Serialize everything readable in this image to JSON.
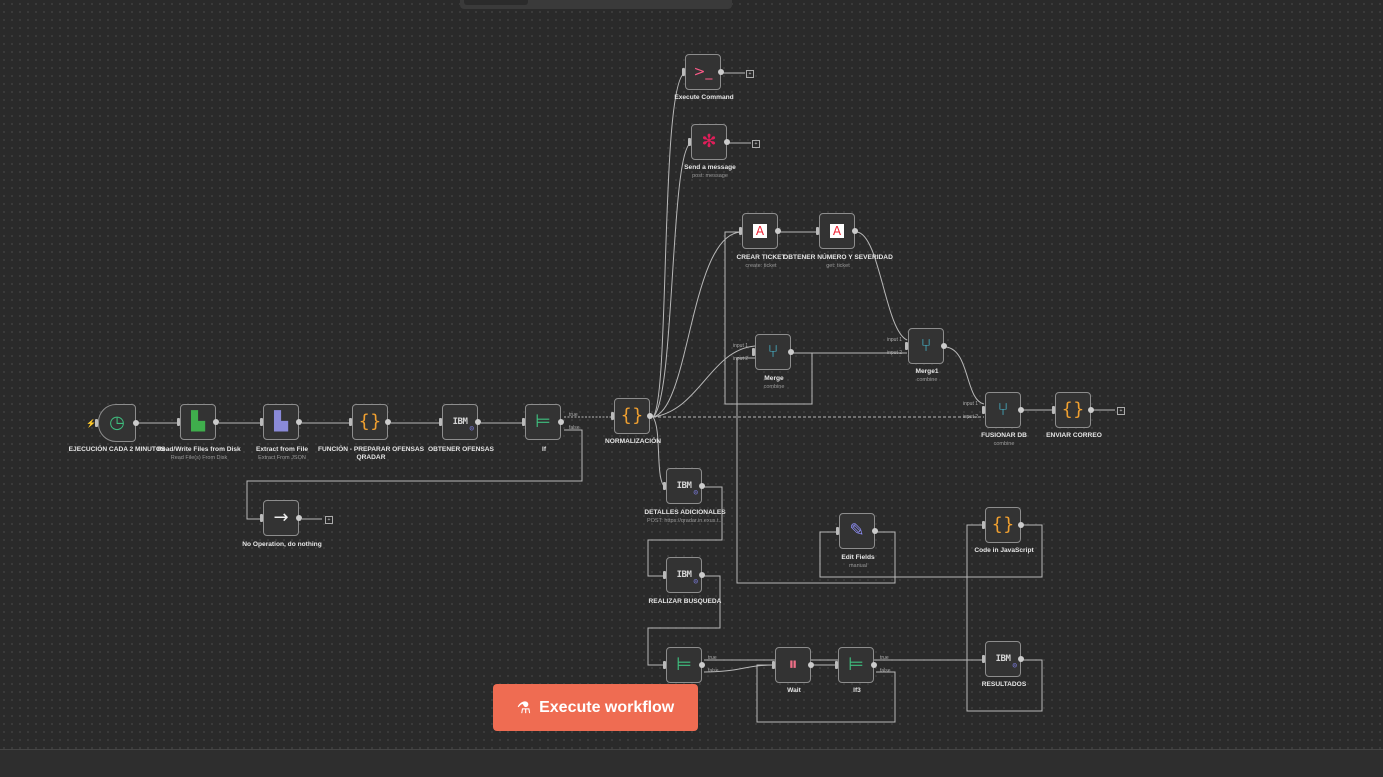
{
  "top_tabs": {
    "active": ""
  },
  "execute_button": {
    "label": "Execute workflow",
    "icon": "flask-icon",
    "color": "#ef6c52"
  },
  "ports": {
    "true_label": "true",
    "false_label": "false",
    "input1": "input 1",
    "input2": "input 2"
  },
  "nodes": {
    "schedule": {
      "title": "EJECUCIÓN CADA 2 MINUTOS",
      "subtitle": "",
      "icon": "clock-icon"
    },
    "read_files": {
      "title": "Read/Write Files from Disk",
      "subtitle": "Read File(s) From Disk",
      "icon": "file-icon"
    },
    "extract": {
      "title": "Extract from File",
      "subtitle": "Extract From JSON",
      "icon": "file-extract-icon"
    },
    "funcion": {
      "title": "FUNCIÓN - PREPARAR OFENSAS QRADAR",
      "subtitle": "",
      "icon": "code-braces-icon"
    },
    "obtener": {
      "title": "OBTENER OFENSAS",
      "subtitle": "",
      "icon": "ibm-icon"
    },
    "if1": {
      "title": "If",
      "subtitle": "",
      "icon": "if-icon"
    },
    "noop": {
      "title": "No Operation, do nothing",
      "subtitle": "",
      "icon": "arrow-right-icon"
    },
    "normal": {
      "title": "NORMALIZACIÓN",
      "subtitle": "",
      "icon": "code-braces-icon"
    },
    "exec_cmd": {
      "title": "Execute Command",
      "subtitle": "",
      "icon": "terminal-icon"
    },
    "slack": {
      "title": "Send a message",
      "subtitle": "post: message",
      "icon": "slack-icon"
    },
    "crear": {
      "title": "CREAR TICKET",
      "subtitle": "create: ticket",
      "icon": "ticket-icon"
    },
    "obtener_num": {
      "title": "OBTENER NÚMERO Y SEVERIDAD",
      "subtitle": "get: ticket",
      "icon": "ticket-icon"
    },
    "merge": {
      "title": "Merge",
      "subtitle": "combine",
      "icon": "merge-icon"
    },
    "merge1": {
      "title": "Merge1",
      "subtitle": "combine",
      "icon": "merge-icon"
    },
    "fusionar": {
      "title": "FUSIONAR DB",
      "subtitle": "combine",
      "icon": "merge-icon"
    },
    "enviar": {
      "title": "ENVIAR CORREO",
      "subtitle": "",
      "icon": "code-braces-icon"
    },
    "detalles": {
      "title": "DETALLES ADICIONALES",
      "subtitle": "POST: https://qradar.in.exus.t...",
      "icon": "ibm-icon"
    },
    "realizar": {
      "title": "REALIZAR BUSQUEDA",
      "subtitle": "",
      "icon": "ibm-icon"
    },
    "if2": {
      "title": "",
      "subtitle": "",
      "icon": "if-icon"
    },
    "wait": {
      "title": "Wait",
      "subtitle": "",
      "icon": "pause-icon"
    },
    "if3": {
      "title": "If3",
      "subtitle": "",
      "icon": "if-icon"
    },
    "edit": {
      "title": "Edit Fields",
      "subtitle": "manual",
      "icon": "pencil-icon"
    },
    "codejs": {
      "title": "Code in JavaScript",
      "subtitle": "",
      "icon": "code-braces-icon"
    },
    "resultados": {
      "title": "RESULTADOS",
      "subtitle": "",
      "icon": "ibm-icon"
    }
  }
}
